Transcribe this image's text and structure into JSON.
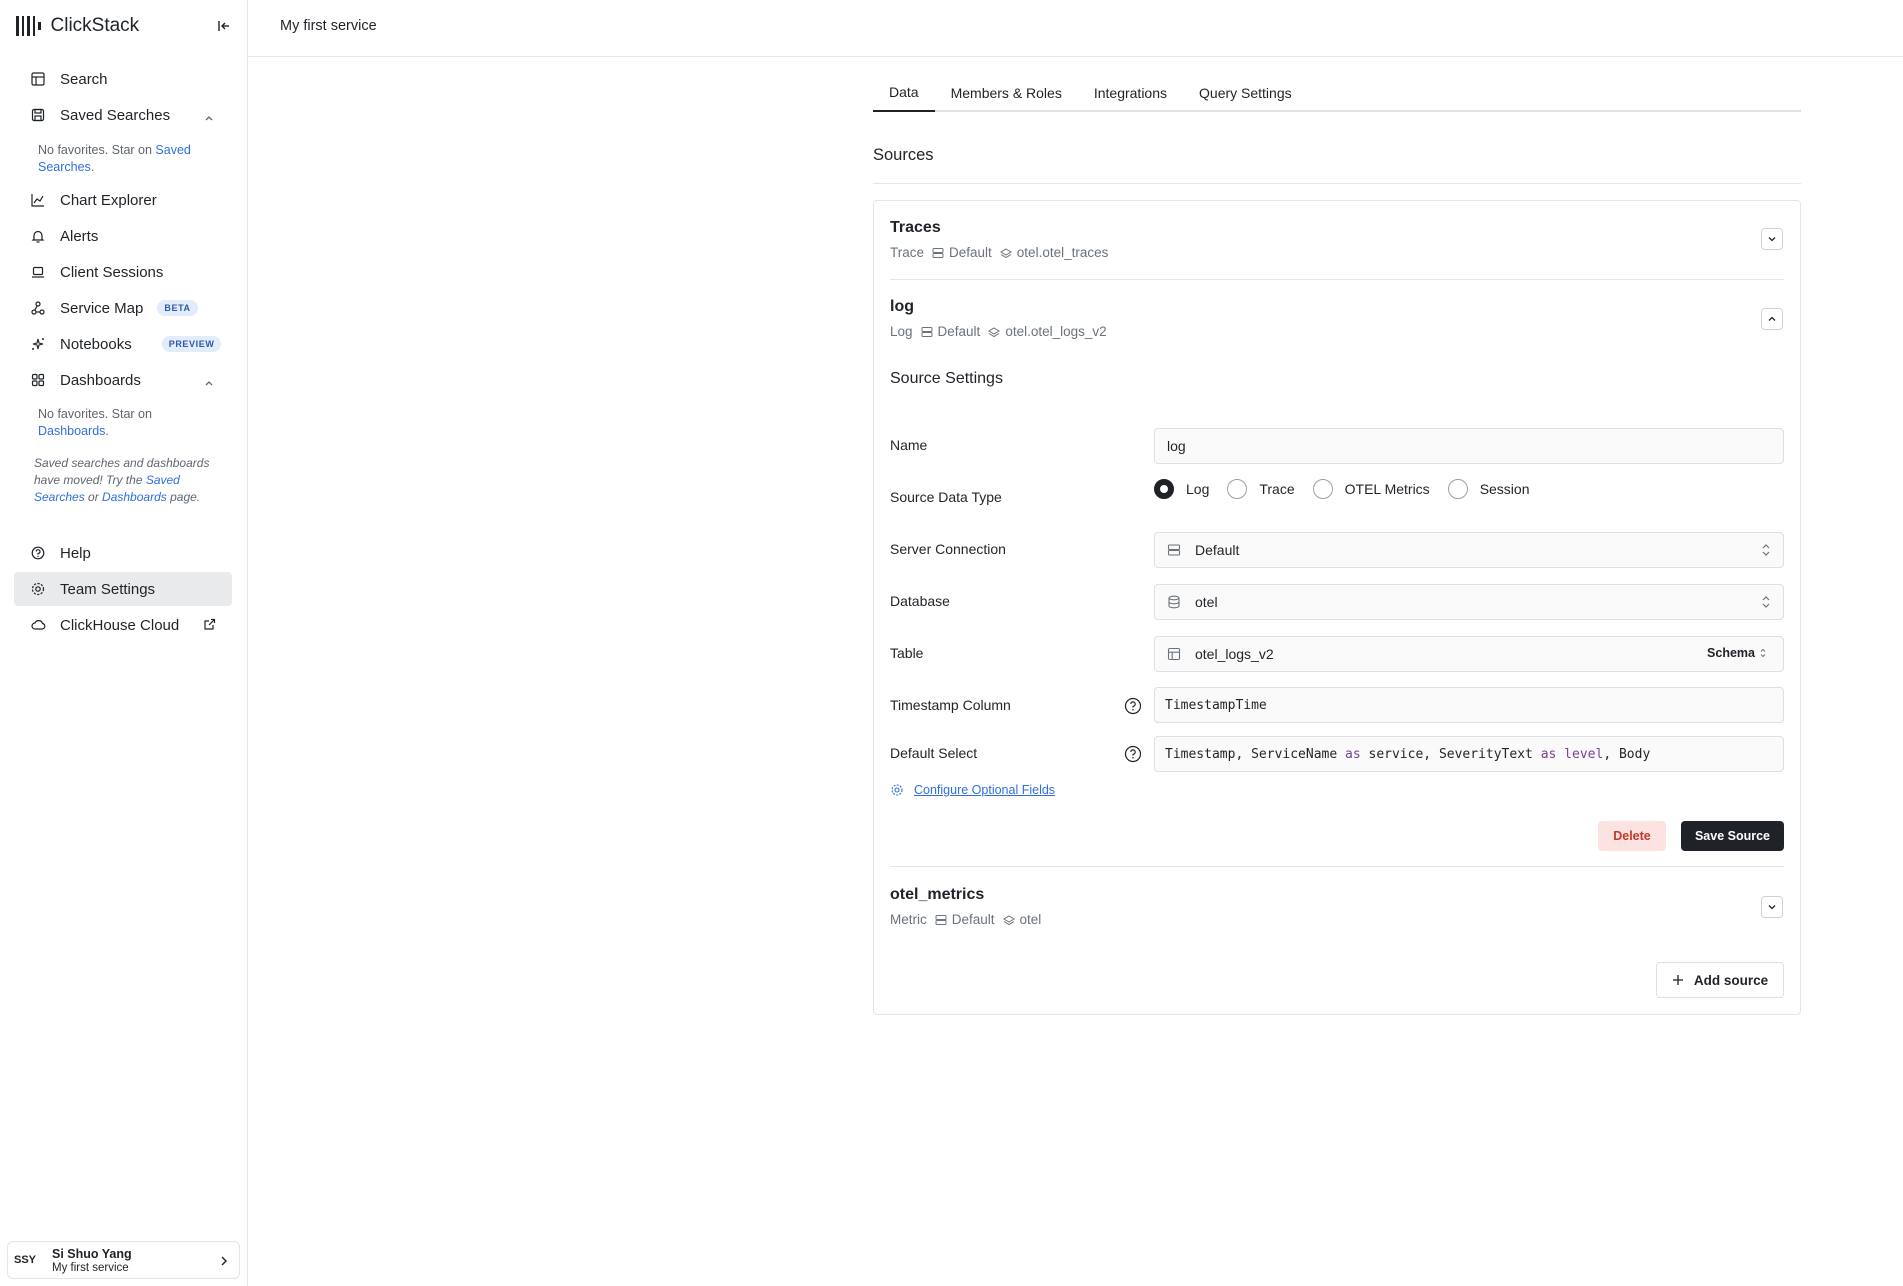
{
  "app": {
    "name": "ClickStack"
  },
  "sidebar": {
    "items": {
      "search": "Search",
      "saved_searches": "Saved Searches",
      "chart_explorer": "Chart Explorer",
      "alerts": "Alerts",
      "client_sessions": "Client Sessions",
      "service_map": "Service Map",
      "notebooks": "Notebooks",
      "dashboards": "Dashboards",
      "help": "Help",
      "team_settings": "Team Settings",
      "clickhouse_cloud": "ClickHouse Cloud"
    },
    "badges": {
      "beta": "BETA",
      "preview": "PREVIEW"
    },
    "saved_searches_note": {
      "prefix": "No favorites. Star on ",
      "link": "Saved Searches",
      "suffix": "."
    },
    "dashboards_note": {
      "prefix": "No favorites. Star on ",
      "link": "Dashboards",
      "suffix": "."
    },
    "moved_note": {
      "part1": "Saved searches and dashboards have moved! Try the ",
      "link1": "Saved Searches",
      "part2": " or ",
      "link2": "Dashboards",
      "part3": " page."
    }
  },
  "user": {
    "initials": "SSY",
    "name": "Si Shuo Yang",
    "service": "My first service"
  },
  "header": {
    "title": "My first service"
  },
  "tabs": [
    "Data",
    "Members & Roles",
    "Integrations",
    "Query Settings"
  ],
  "sources": {
    "title": "Sources",
    "list": [
      {
        "name": "Traces",
        "type": "Trace",
        "connection": "Default",
        "table": "otel.otel_traces"
      },
      {
        "name": "log",
        "type": "Log",
        "connection": "Default",
        "table": "otel.otel_logs_v2"
      },
      {
        "name": "otel_metrics",
        "type": "Metric",
        "connection": "Default",
        "table": "otel"
      }
    ],
    "add_label": "Add source"
  },
  "source_settings": {
    "title": "Source Settings",
    "labels": {
      "name": "Name",
      "source_data_type": "Source Data Type",
      "server_connection": "Server Connection",
      "database": "Database",
      "table": "Table",
      "timestamp_column": "Timestamp Column",
      "default_select": "Default Select"
    },
    "values": {
      "name": "log",
      "server_connection": "Default",
      "database": "otel",
      "table": "otel_logs_v2",
      "timestamp_column": "TimestampTime"
    },
    "default_select": {
      "p1": "Timestamp, ServiceName ",
      "k1": "as",
      "p2": " service, SeverityText ",
      "k2": "as",
      "p3": " ",
      "k3": "level",
      "p4": ", Body"
    },
    "data_types": [
      "Log",
      "Trace",
      "OTEL Metrics",
      "Session"
    ],
    "selected_type": "Log",
    "schema_label": "Schema",
    "optional_fields_link": "Configure Optional Fields",
    "delete_label": "Delete",
    "save_label": "Save Source"
  }
}
